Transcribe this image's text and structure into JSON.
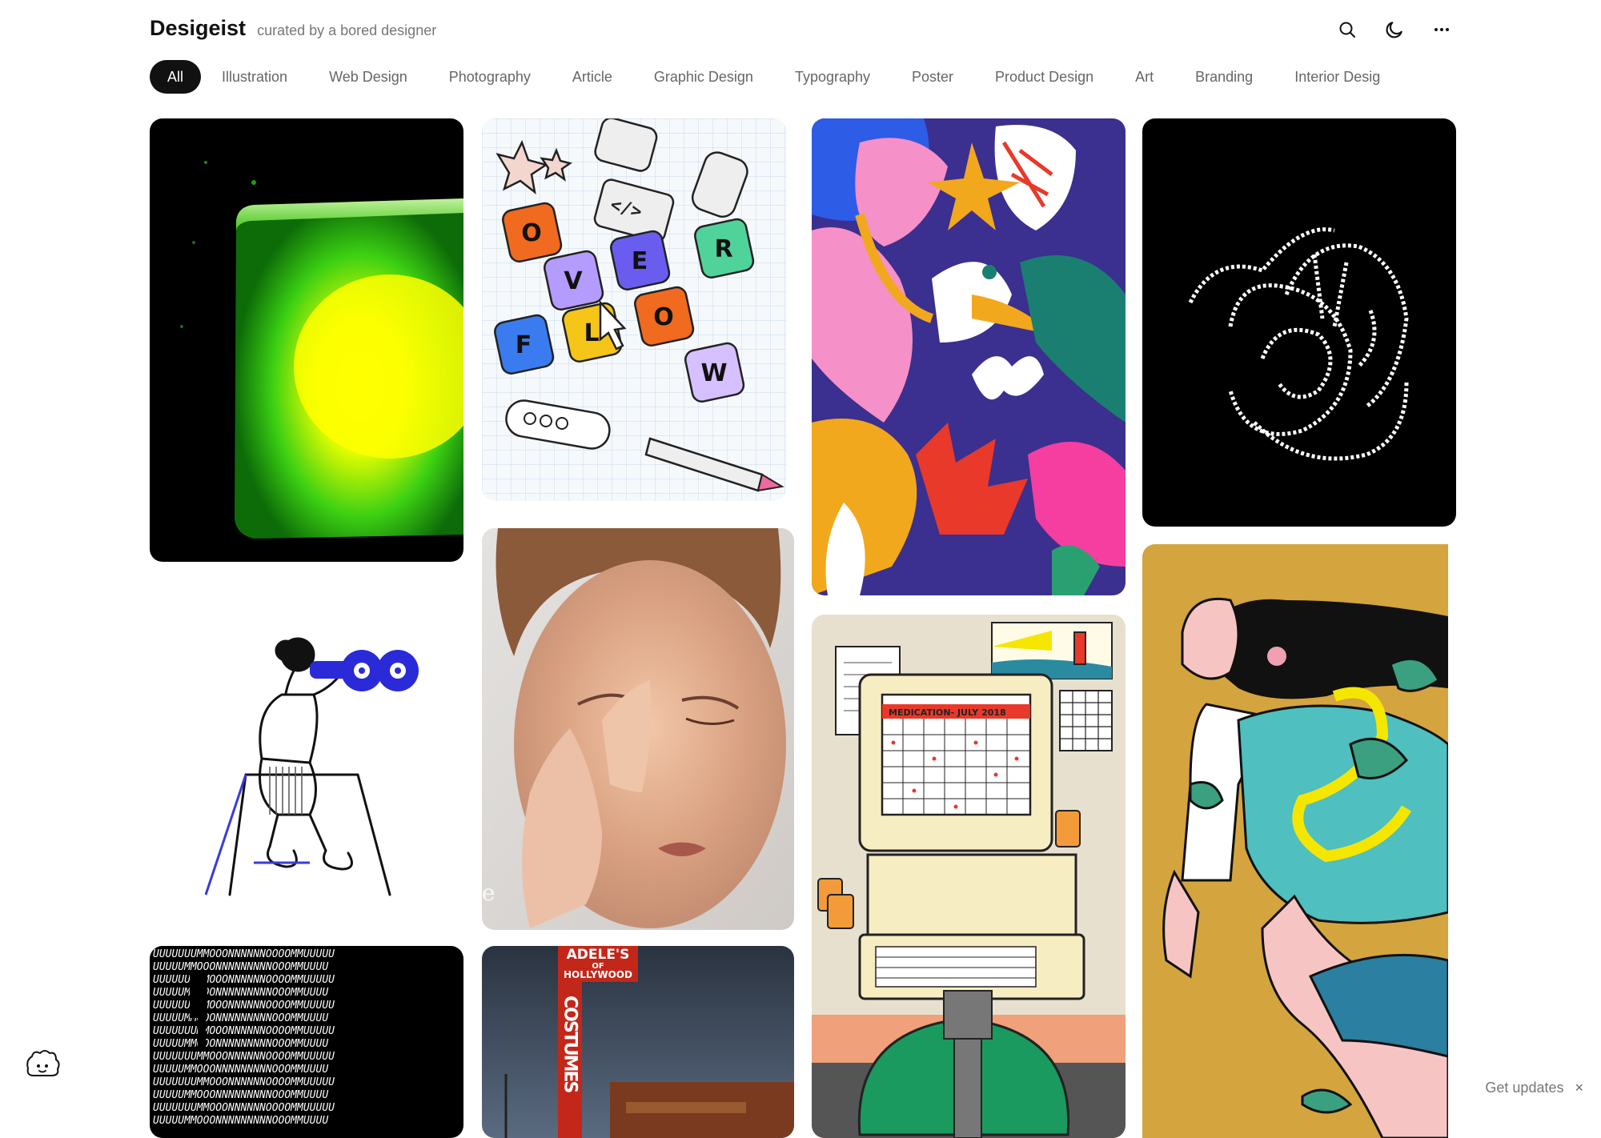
{
  "header": {
    "title": "Desigeist",
    "tagline": "curated by a bored designer",
    "icons": [
      "search-icon",
      "moon-icon",
      "more-icon"
    ]
  },
  "categories": [
    {
      "label": "All",
      "active": true
    },
    {
      "label": "Illustration"
    },
    {
      "label": "Web Design"
    },
    {
      "label": "Photography"
    },
    {
      "label": "Article"
    },
    {
      "label": "Graphic Design"
    },
    {
      "label": "Typography"
    },
    {
      "label": "Poster"
    },
    {
      "label": "Product Design"
    },
    {
      "label": "Art"
    },
    {
      "label": "Branding"
    },
    {
      "label": "Interior Desig"
    }
  ],
  "cards": {
    "overflow_letters": [
      "O",
      "V",
      "E",
      "R",
      "F",
      "L",
      "O",
      "W"
    ],
    "calendar_title": "MEDICATION- JULY 2018",
    "sign_top": "ADELE'S",
    "sign_of": "OF",
    "sign_hollywood": "HOLLYWOOD",
    "sign_vertical": "COSTUMES",
    "type_row_a": "UUUUUUUMMOOONNNNNNOOOOMMUUUUU",
    "type_row_b": "UUUUUMMOOONNNNNNNNNOOOMMUUUU",
    "face_caption": "e"
  },
  "footer": {
    "updates_label": "Get updates",
    "close_glyph": "×"
  },
  "colors": {
    "ink": "#111111",
    "muted": "#777777",
    "chip_active_bg": "#111111"
  }
}
